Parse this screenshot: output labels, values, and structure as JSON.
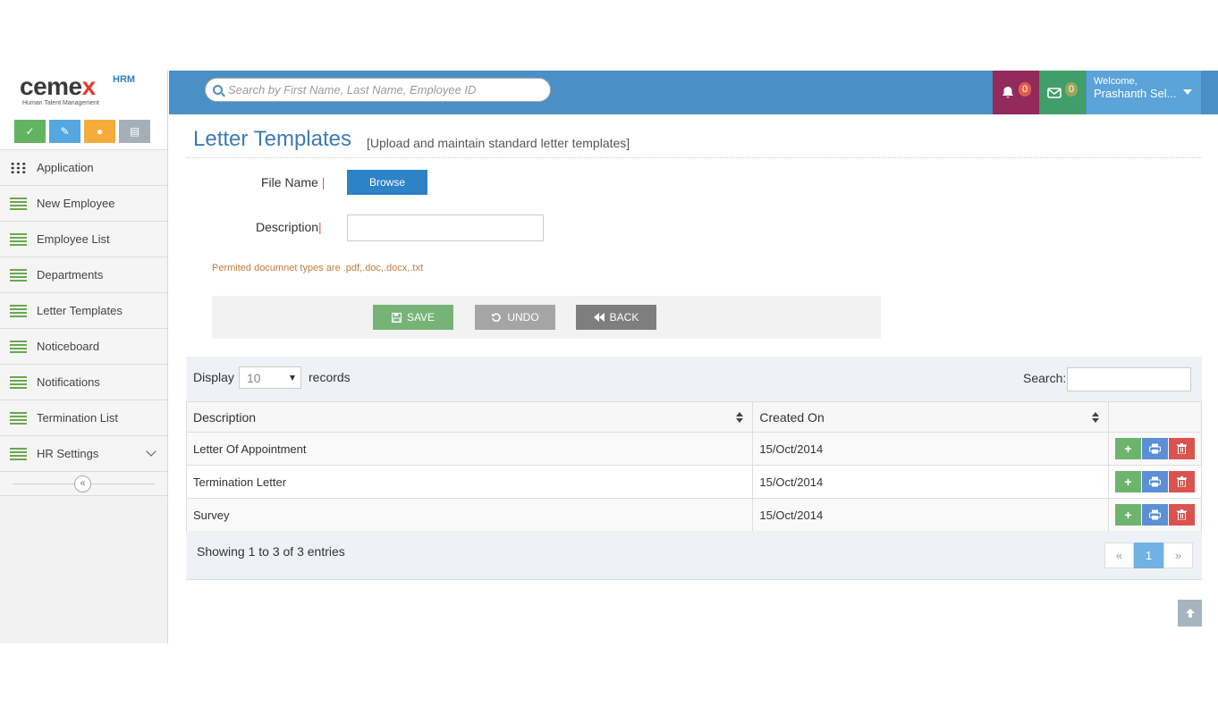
{
  "brand": {
    "name_part1": "cem",
    "name_part2": "e",
    "name_x": "x",
    "hrm": "HRM",
    "tagline": "Human Talent Management"
  },
  "shortcuts": [
    {
      "icon": "check-icon"
    },
    {
      "icon": "edit-icon"
    },
    {
      "icon": "user-icon"
    },
    {
      "icon": "chart-icon"
    }
  ],
  "sidebar": {
    "items": [
      {
        "label": "Application",
        "icon": "grid-icon"
      },
      {
        "label": "New Employee",
        "icon": "list-icon"
      },
      {
        "label": "Employee List",
        "icon": "list-icon"
      },
      {
        "label": "Departments",
        "icon": "list-icon"
      },
      {
        "label": "Letter Templates",
        "icon": "list-icon"
      },
      {
        "label": "Noticeboard",
        "icon": "list-icon"
      },
      {
        "label": "Notifications",
        "icon": "list-icon"
      },
      {
        "label": "Termination List",
        "icon": "list-icon"
      },
      {
        "label": "HR Settings",
        "icon": "list-icon"
      }
    ],
    "collapse_glyph": "«"
  },
  "header": {
    "search_placeholder": "Search by First Name, Last Name, Employee ID",
    "notifications_count": "0",
    "messages_count": "0",
    "welcome": "Welcome,",
    "user_name": "Prashanth Sel..."
  },
  "page": {
    "title": "Letter Templates",
    "subtitle": "[Upload and maintain standard letter templates]"
  },
  "form": {
    "file_name_label": "File Name",
    "required_mark": "|",
    "browse_label": "Browse",
    "description_label": "Description",
    "permitted_note": "Permited documnet types are .pdf,.doc,.docx,.txt",
    "save_label": "SAVE",
    "undo_label": "UNDO",
    "back_label": "BACK"
  },
  "table": {
    "display_label": "Display",
    "display_value": "10",
    "records_label": "records",
    "search_label": "Search:",
    "columns": [
      "Description",
      "Created On"
    ],
    "rows": [
      {
        "description": "Letter Of Appointment",
        "created_on": "15/Oct/2014"
      },
      {
        "description": "Termination Letter",
        "created_on": "15/Oct/2014"
      },
      {
        "description": "Survey",
        "created_on": "15/Oct/2014"
      }
    ],
    "showing": "Showing 1 to 3 of 3 entries",
    "pager": {
      "prev": "«",
      "current": "1",
      "next": "»"
    }
  },
  "colors": {
    "accent": "#4a8fc6",
    "title": "#3d7ab4",
    "bell_bg": "#922a5b",
    "mail_bg": "#3f9e6a"
  }
}
